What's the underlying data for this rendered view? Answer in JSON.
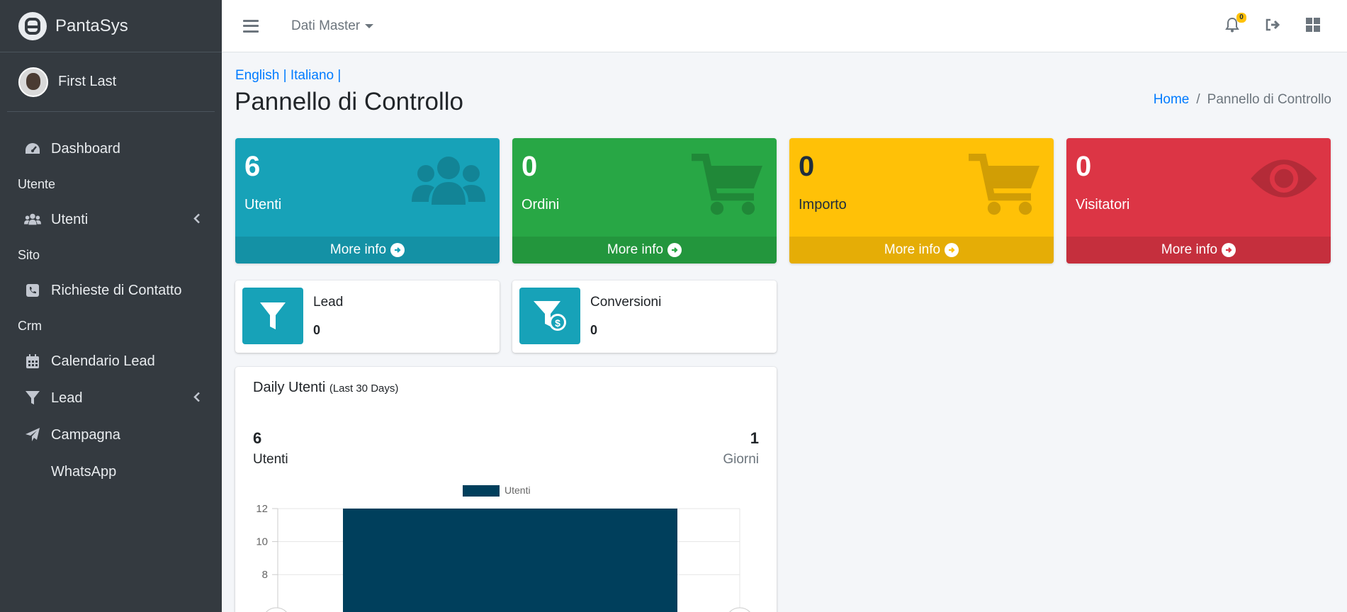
{
  "brand": {
    "name": "PantaSys"
  },
  "user": {
    "name": "First Last"
  },
  "sidebar": {
    "items": [
      {
        "type": "item",
        "label": "Dashboard",
        "icon": "tachometer-icon"
      },
      {
        "type": "header",
        "label": "Utente"
      },
      {
        "type": "item",
        "label": "Utenti",
        "icon": "users-icon",
        "chevron": true
      },
      {
        "type": "header",
        "label": "Sito"
      },
      {
        "type": "item",
        "label": "Richieste di Contatto",
        "icon": "phone-square-icon"
      },
      {
        "type": "header",
        "label": "Crm"
      },
      {
        "type": "item",
        "label": "Calendario Lead",
        "icon": "calendar-icon"
      },
      {
        "type": "item",
        "label": "Lead",
        "icon": "filter-icon",
        "chevron": true
      },
      {
        "type": "item",
        "label": "Campagna",
        "icon": "paper-plane-icon"
      },
      {
        "type": "item",
        "label": "WhatsApp",
        "icon": ""
      }
    ]
  },
  "topbar": {
    "menu_label": "Dati Master",
    "notification_count": "0"
  },
  "lang": {
    "english": "English",
    "italiano": "Italiano",
    "sep": "|"
  },
  "page": {
    "title": "Pannello di Controllo"
  },
  "breadcrumb": {
    "home": "Home",
    "sep": "/",
    "current": "Pannello di Controllo"
  },
  "small_boxes": [
    {
      "value": "6",
      "label": "Utenti",
      "footer": "More info",
      "color": "#17a2b8",
      "icon": "users-icon"
    },
    {
      "value": "0",
      "label": "Ordini",
      "footer": "More info",
      "color": "#28a745",
      "icon": "shopping-cart-icon"
    },
    {
      "value": "0",
      "label": "Importo",
      "footer": "More info",
      "color": "#ffc107",
      "icon": "shopping-cart-icon"
    },
    {
      "value": "0",
      "label": "Visitatori",
      "footer": "More info",
      "color": "#dc3545",
      "icon": "eye-icon"
    }
  ],
  "info_boxes": [
    {
      "label": "Lead",
      "value": "0",
      "icon": "filter-icon"
    },
    {
      "label": "Conversioni",
      "value": "0",
      "icon": "filter-dollar-icon"
    }
  ],
  "daily_card": {
    "title": "Daily Utenti",
    "subtitle": "(Last 30 Days)",
    "left_value": "6",
    "left_label": "Utenti",
    "right_value": "1",
    "right_label": "Giorni"
  },
  "chart_data": {
    "type": "bar",
    "categories": [
      ""
    ],
    "series": [
      {
        "name": "Utenti",
        "values": [
          12
        ],
        "color": "#003f5c"
      }
    ],
    "yticks": [
      8,
      10,
      12
    ],
    "ylim": [
      0,
      12
    ],
    "legend": "top"
  }
}
